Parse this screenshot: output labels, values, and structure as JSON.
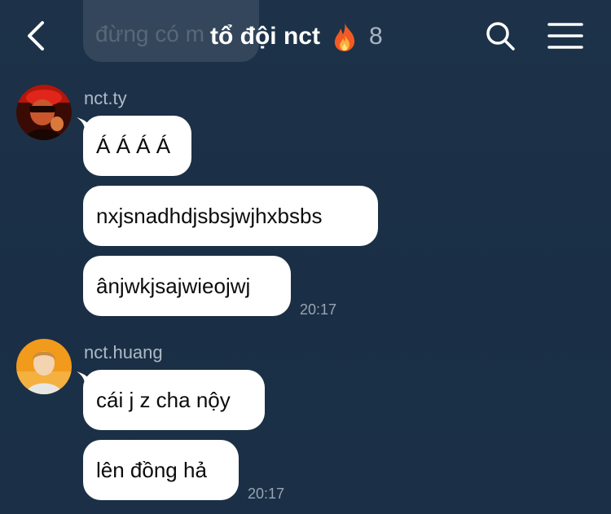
{
  "header": {
    "previous_message_preview": "đừng có m",
    "title": "tổ đội nct",
    "member_count": "8",
    "icons": [
      "back-chevron-icon",
      "fire-emoji-icon",
      "search-icon",
      "menu-icon"
    ]
  },
  "colors": {
    "background": "#1c3148",
    "bubble": "#ffffff",
    "bubble_text": "#0c0c0c",
    "name_text": "#aeb9c6",
    "time_text": "#97a4b3"
  },
  "groups": [
    {
      "sender": "nct.ty",
      "avatar": "avatar-icon",
      "messages": [
        "Á Á Á Á",
        "nxjsnadhdjsbsjwjhxbsbs",
        "ânjwkjsajwieojwj"
      ],
      "time": "20:17"
    },
    {
      "sender": "nct.huang",
      "avatar": "avatar-icon",
      "messages": [
        "cái j z cha nộy",
        "lên đồng hả"
      ],
      "time": "20:17"
    }
  ]
}
